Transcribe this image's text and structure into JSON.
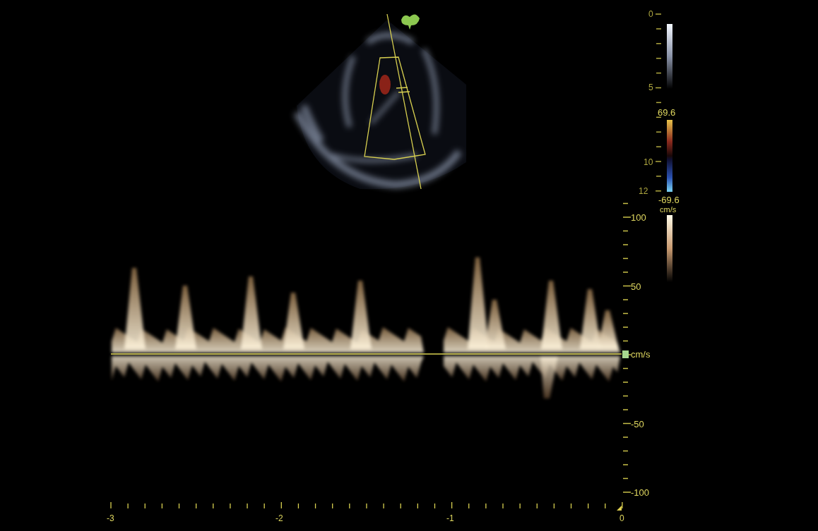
{
  "depth_scale": {
    "labels": [
      "0",
      "5",
      "10",
      "12"
    ]
  },
  "color_bar": {
    "max": "69.6",
    "min": "-69.6",
    "unit": "cm/s"
  },
  "velocity_scale": {
    "labels": [
      "100",
      "50",
      "cm/s",
      "-50",
      "-100"
    ]
  },
  "time_axis": {
    "labels": [
      "-3",
      "-2",
      "-1",
      "0"
    ]
  }
}
